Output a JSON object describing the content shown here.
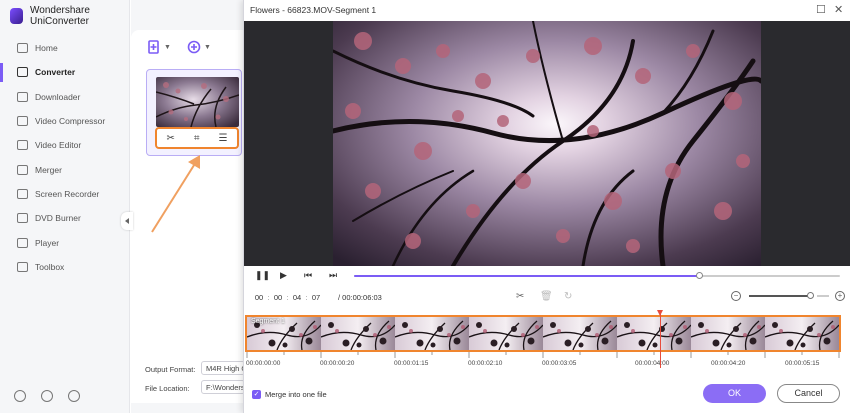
{
  "app": {
    "title": "Wondershare UniConverter",
    "accent_color": "#7b5cf5"
  },
  "sidebar": {
    "items": [
      {
        "label": "Home",
        "icon": "home-icon"
      },
      {
        "label": "Converter",
        "icon": "converter-icon",
        "active": true
      },
      {
        "label": "Downloader",
        "icon": "downloader-icon"
      },
      {
        "label": "Video Compressor",
        "icon": "compressor-icon"
      },
      {
        "label": "Video Editor",
        "icon": "video-editor-icon"
      },
      {
        "label": "Merger",
        "icon": "merger-icon"
      },
      {
        "label": "Screen Recorder",
        "icon": "screen-recorder-icon"
      },
      {
        "label": "DVD Burner",
        "icon": "dvd-icon"
      },
      {
        "label": "Player",
        "icon": "player-icon"
      },
      {
        "label": "Toolbox",
        "icon": "toolbox-icon"
      }
    ],
    "bottom_icons": [
      "help-icon",
      "bell-icon",
      "feedback-icon"
    ]
  },
  "converter": {
    "add_file_icon": "add-file-icon",
    "add_more_icon": "add-more-icon",
    "card_actions": [
      "trim-icon",
      "crop-icon",
      "effects-icon"
    ],
    "output_format_label": "Output Format:",
    "output_format_value": "M4R High Q",
    "file_location_label": "File Location:",
    "file_location_value": "F:\\Wonders"
  },
  "modal": {
    "title": "Flowers - 66823.MOV-Segment 1",
    "playback_progress": 0.71,
    "current_time": {
      "hh": "00",
      "mm": "00",
      "ss": "04",
      "ff": "07"
    },
    "total_time": "/ 00:00:06:03",
    "zoom_level": 0.9,
    "segment_label": "Segment 1",
    "ruler": [
      "00:00:00:00",
      "00:00:00:20",
      "00:00:01:15",
      "00:00:02:10",
      "00:00:03:05",
      "00:00:04:00",
      "00:00:04:20",
      "00:00:05:15"
    ],
    "merge_label": "Merge into one file",
    "merge_checked": true,
    "ok_label": "OK",
    "cancel_label": "Cancel"
  }
}
